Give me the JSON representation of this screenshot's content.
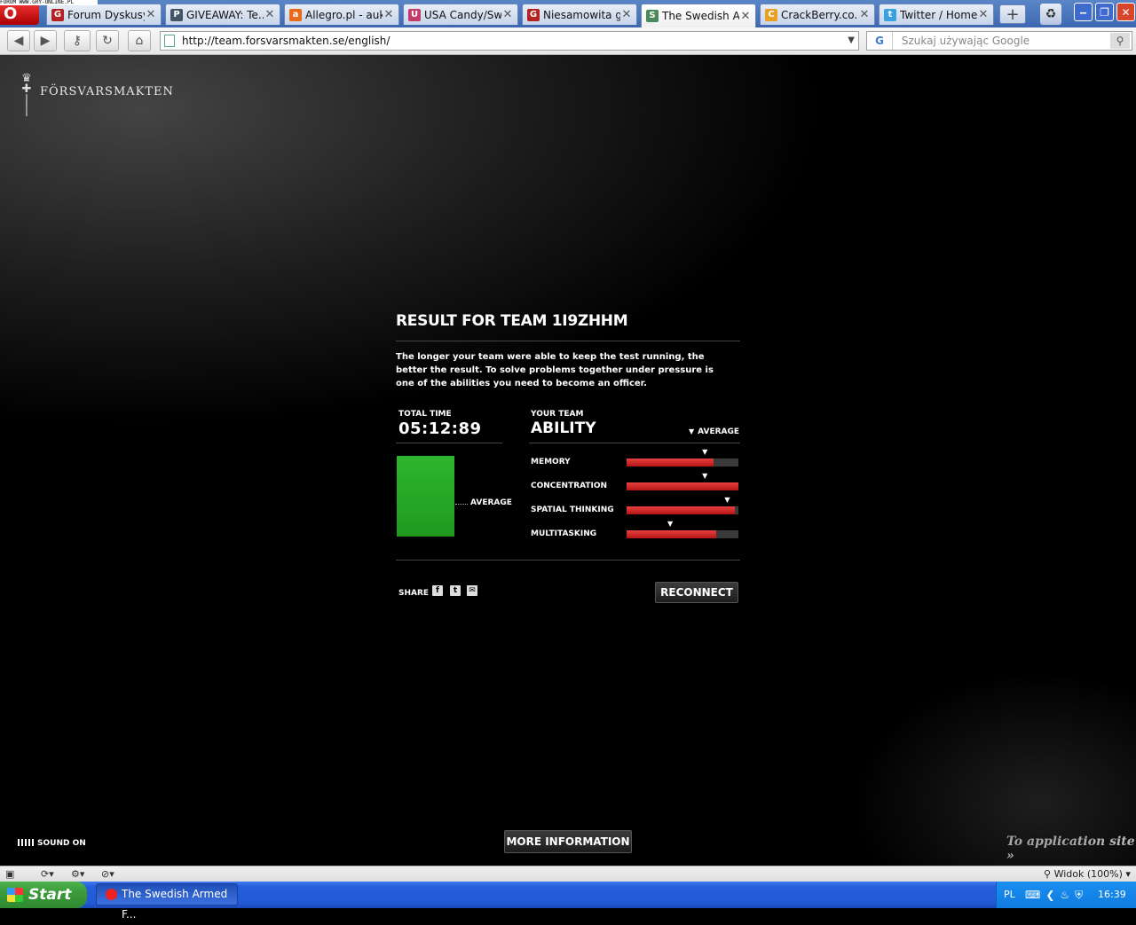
{
  "top_status": "FORUM WWW.GRY-ONLINE.PL",
  "browser": {
    "opera_label": "O",
    "tabs": [
      {
        "title": "Forum Dyskusy...",
        "fav": "G",
        "favcolor": "#b22222",
        "active": false
      },
      {
        "title": "GIVEAWAY: Te...",
        "fav": "P",
        "favcolor": "#445566",
        "active": false
      },
      {
        "title": "Allegro.pl - auk...",
        "fav": "a",
        "favcolor": "#e86a1a",
        "active": false
      },
      {
        "title": "USA Candy/Sw...",
        "fav": "U",
        "favcolor": "#c23b6b",
        "active": false
      },
      {
        "title": "Niesamowita gr...",
        "fav": "G",
        "favcolor": "#b22222",
        "active": false
      },
      {
        "title": "The Swedish A...",
        "fav": "S",
        "favcolor": "#4a8a5a",
        "active": true
      },
      {
        "title": "CrackBerry.co...",
        "fav": "C",
        "favcolor": "#e8a020",
        "active": false
      },
      {
        "title": "Twitter / Home",
        "fav": "t",
        "favcolor": "#3aa0e0",
        "active": false
      }
    ],
    "new_tab": "+",
    "url": "http://team.forsvarsmakten.se/english/",
    "search_placeholder": "Szukaj używając Google",
    "search_engine": "G"
  },
  "page": {
    "logo_text": "FÖRSVARSMAKTEN",
    "result_title": "RESULT FOR TEAM 1I9ZHHM",
    "description": "The longer your team were able to keep the test running, the better the result. To solve problems together under pressure is one of the abilities you need to become an officer.",
    "total_time_label": "TOTAL TIME",
    "total_time_value": "05:12:89",
    "left_average_label": "AVERAGE",
    "your_team_label": "YOUR TEAM",
    "ability_label": "ABILITY",
    "average_legend": "AVERAGE",
    "abilities": [
      {
        "label": "MEMORY",
        "team": 0.78,
        "average": 0.7
      },
      {
        "label": "CONCENTRATION",
        "team": 1.0,
        "average": 0.7
      },
      {
        "label": "SPATIAL THINKING",
        "team": 0.97,
        "average": 0.9
      },
      {
        "label": "MULTITASKING",
        "team": 0.8,
        "average": 0.39
      }
    ],
    "share_label": "SHARE",
    "share_icons": [
      "facebook-icon",
      "twitter-icon",
      "mail-icon"
    ],
    "reconnect_label": "RECONNECT",
    "sound_label": "SOUND ON",
    "more_info_label": "MORE INFORMATION",
    "app_site_label": "To application site »",
    "accent_green": "#2eb62e",
    "accent_red": "#d02020"
  },
  "statusbar": {
    "zoom": "Widok (100%)"
  },
  "taskbar": {
    "start_label": "Start",
    "task_label": "The Swedish Armed F...",
    "lang": "PL",
    "clock": "16:39"
  }
}
